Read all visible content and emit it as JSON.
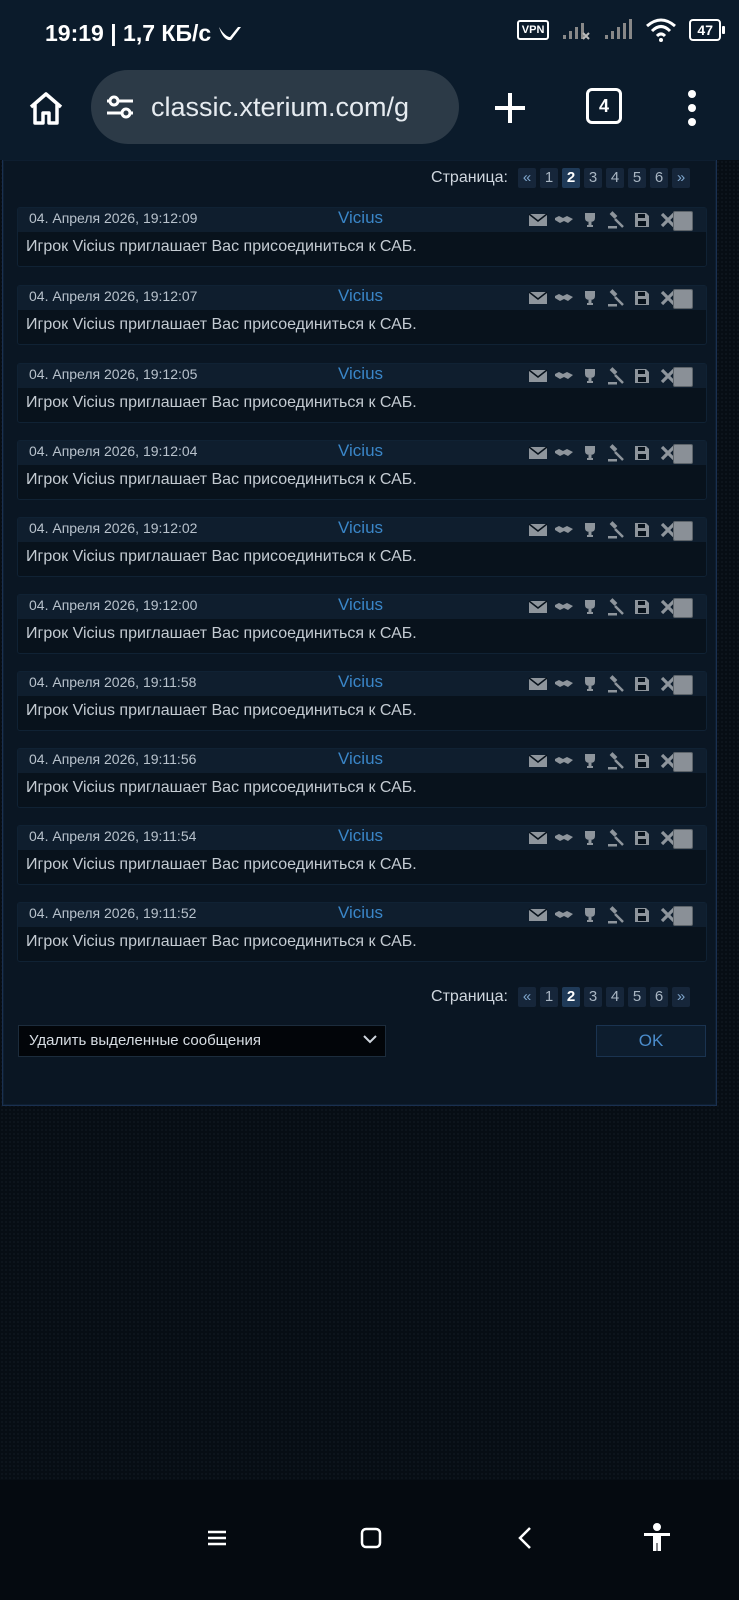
{
  "status_bar": {
    "time": "19:19",
    "speed": "| 1,7 КБ/с",
    "vpn": "VPN",
    "battery": "47"
  },
  "browser": {
    "url": "classic.xterium.com/g",
    "tab_count": "4"
  },
  "pagination": {
    "label": "Страница:",
    "prev": "«",
    "next": "»",
    "pages": [
      "1",
      "2",
      "3",
      "4",
      "5",
      "6"
    ],
    "current": "2"
  },
  "messages": [
    {
      "date": "04. Апреля 2026, 19:12:09",
      "sender": "Vicius",
      "text": "Игрок Vicius приглашает Вас присоединиться к САБ."
    },
    {
      "date": "04. Апреля 2026, 19:12:07",
      "sender": "Vicius",
      "text": "Игрок Vicius приглашает Вас присоединиться к САБ."
    },
    {
      "date": "04. Апреля 2026, 19:12:05",
      "sender": "Vicius",
      "text": "Игрок Vicius приглашает Вас присоединиться к САБ."
    },
    {
      "date": "04. Апреля 2026, 19:12:04",
      "sender": "Vicius",
      "text": "Игрок Vicius приглашает Вас присоединиться к САБ."
    },
    {
      "date": "04. Апреля 2026, 19:12:02",
      "sender": "Vicius",
      "text": "Игрок Vicius приглашает Вас присоединиться к САБ."
    },
    {
      "date": "04. Апреля 2026, 19:12:00",
      "sender": "Vicius",
      "text": "Игрок Vicius приглашает Вас присоединиться к САБ."
    },
    {
      "date": "04. Апреля 2026, 19:11:58",
      "sender": "Vicius",
      "text": "Игрок Vicius приглашает Вас присоединиться к САБ."
    },
    {
      "date": "04. Апреля 2026, 19:11:56",
      "sender": "Vicius",
      "text": "Игрок Vicius приглашает Вас присоединиться к САБ."
    },
    {
      "date": "04. Апреля 2026, 19:11:54",
      "sender": "Vicius",
      "text": "Игрок Vicius приглашает Вас присоединиться к САБ."
    },
    {
      "date": "04. Апреля 2026, 19:11:52",
      "sender": "Vicius",
      "text": "Игрок Vicius приглашает Вас присоединиться к САБ."
    }
  ],
  "message_actions": [
    "mail-icon",
    "handshake-icon",
    "trophy-icon",
    "gavel-icon",
    "save-icon",
    "delete-icon"
  ],
  "bulk_action": {
    "selected": "Удалить выделенные сообщения",
    "ok_label": "OK"
  },
  "colors": {
    "accent": "#3a86c8",
    "panel_bg": "#0a1623",
    "page_bg": "#070d14"
  }
}
